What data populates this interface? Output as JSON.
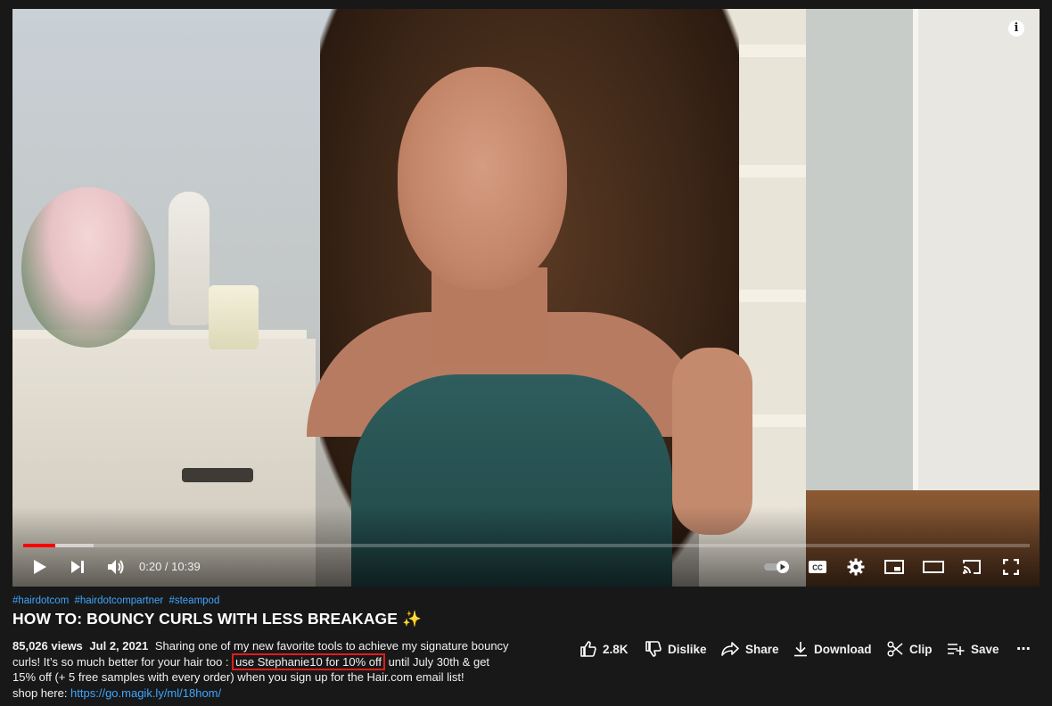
{
  "player": {
    "time_display": "0:20 / 10:39",
    "progress_played": 0.032,
    "progress_buffered": 0.07,
    "info_label": "i",
    "accent_color": "#ff0000"
  },
  "video": {
    "hashtags": [
      "#hairdotcom",
      "#hairdotcompartner",
      "#steampod"
    ],
    "title": "HOW TO: BOUNCY CURLS WITH LESS BREAKAGE ✨"
  },
  "description": {
    "views": "85,026 views",
    "date": "Jul 2, 2021",
    "text_part1": "Sharing one of my new favorite tools to achieve my signature bouncy curls! It’s so much better for your hair too : ",
    "coupon": "use Stephanie10 for 10% off",
    "text_part2": " until July 30th & get 15% off (+ 5 free samples with every order) when you sign up for the Hair.com email list!",
    "shop_label": "shop here: ",
    "shop_link": "https://go.magik.ly/ml/18hom/"
  },
  "actions": {
    "like_count": "2.8K",
    "dislike_label": "Dislike",
    "share_label": "Share",
    "download_label": "Download",
    "clip_label": "Clip",
    "save_label": "Save",
    "more_label": "⋯"
  }
}
